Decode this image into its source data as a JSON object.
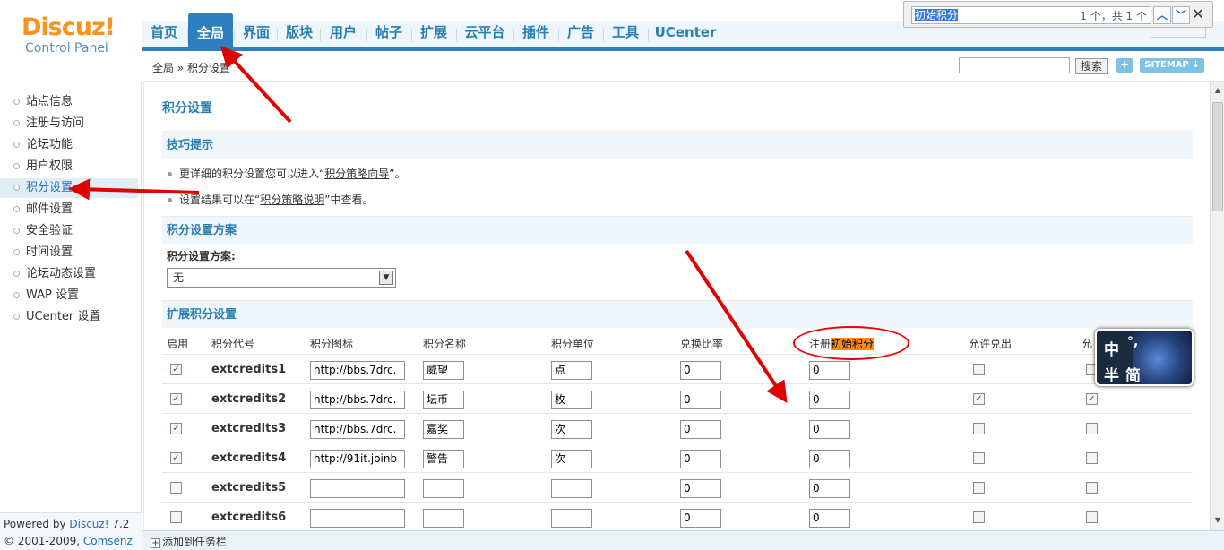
{
  "logo": {
    "main": "Discuz!",
    "sub": "Control Panel"
  },
  "nav": {
    "items": [
      "首页",
      "全局",
      "界面",
      "版块",
      "用户",
      "帖子",
      "扩展",
      "云平台",
      "插件",
      "广告",
      "工具",
      "UCenter"
    ],
    "active": "全局"
  },
  "findbar": {
    "query": "初始积分",
    "count": "1 个，共 1 个"
  },
  "breadcrumb": "全局 » 积分设置",
  "toolbar": {
    "search_button": "搜索",
    "sitemap_button": "SITEMAP"
  },
  "sidebar": {
    "items": [
      "站点信息",
      "注册与访问",
      "论坛功能",
      "用户权限",
      "积分设置",
      "邮件设置",
      "安全验证",
      "时间设置",
      "论坛动态设置",
      "WAP 设置",
      "UCenter 设置"
    ],
    "active": "积分设置",
    "footer_powered_prefix": "Powered by ",
    "footer_powered_link": "Discuz!",
    "footer_powered_version": " 7.2",
    "footer_copyright_prefix": "© 2001-2009, ",
    "footer_copyright_link": "Comsenz Inc."
  },
  "page": {
    "title": "积分设置",
    "tips_heading": "技巧提示",
    "tip1_pre": "更详细的积分设置您可以进入“",
    "tip1_link": "积分策略向导",
    "tip1_post": "”。",
    "tip2_pre": "设置结果可以在“",
    "tip2_link": "积分策略说明",
    "tip2_post": "”中查看。",
    "scheme_heading": "积分设置方案",
    "scheme_label": "积分设置方案:",
    "scheme_value": "无",
    "ext_heading": "扩展积分设置"
  },
  "table": {
    "headers": [
      "启用",
      "积分代号",
      "积分图标",
      "积分名称",
      "积分单位",
      "兑换比率",
      "注册初始积分",
      "允许兑出",
      "允"
    ],
    "header_init_prefix": "注册",
    "header_init_hit": "初始积分",
    "rows": [
      {
        "enabled": true,
        "code": "extcredits1",
        "icon": "http://bbs.7drc.",
        "name": "威望",
        "unit": "点",
        "ratio": "0",
        "init": "0",
        "allow_out": false,
        "allow_in": false
      },
      {
        "enabled": true,
        "code": "extcredits2",
        "icon": "http://bbs.7drc.",
        "name": "坛币",
        "unit": "枚",
        "ratio": "0",
        "init": "0",
        "allow_out": true,
        "allow_in": true
      },
      {
        "enabled": true,
        "code": "extcredits3",
        "icon": "http://bbs.7drc.",
        "name": "嘉奖",
        "unit": "次",
        "ratio": "0",
        "init": "0",
        "allow_out": false,
        "allow_in": false
      },
      {
        "enabled": true,
        "code": "extcredits4",
        "icon": "http://91it.joinb",
        "name": "警告",
        "unit": "次",
        "ratio": "0",
        "init": "0",
        "allow_out": false,
        "allow_in": false
      },
      {
        "enabled": false,
        "code": "extcredits5",
        "icon": "",
        "name": "",
        "unit": "",
        "ratio": "0",
        "init": "0",
        "allow_out": false,
        "allow_in": false
      },
      {
        "enabled": false,
        "code": "extcredits6",
        "icon": "",
        "name": "",
        "unit": "",
        "ratio": "0",
        "init": "0",
        "allow_out": false,
        "allow_in": false
      }
    ]
  },
  "ime": {
    "line1_a": "中",
    "line1_b": "°,",
    "line2_a": "半",
    "line2_b": "简"
  },
  "taskbar": {
    "add_label": "添加到任务栏"
  },
  "colors": {
    "accent": "#2a80b0",
    "nav_active": "#2f7fbf",
    "logo": "#f7941d",
    "annotation": "#e00000",
    "find_hit": "#ff8c1a"
  }
}
